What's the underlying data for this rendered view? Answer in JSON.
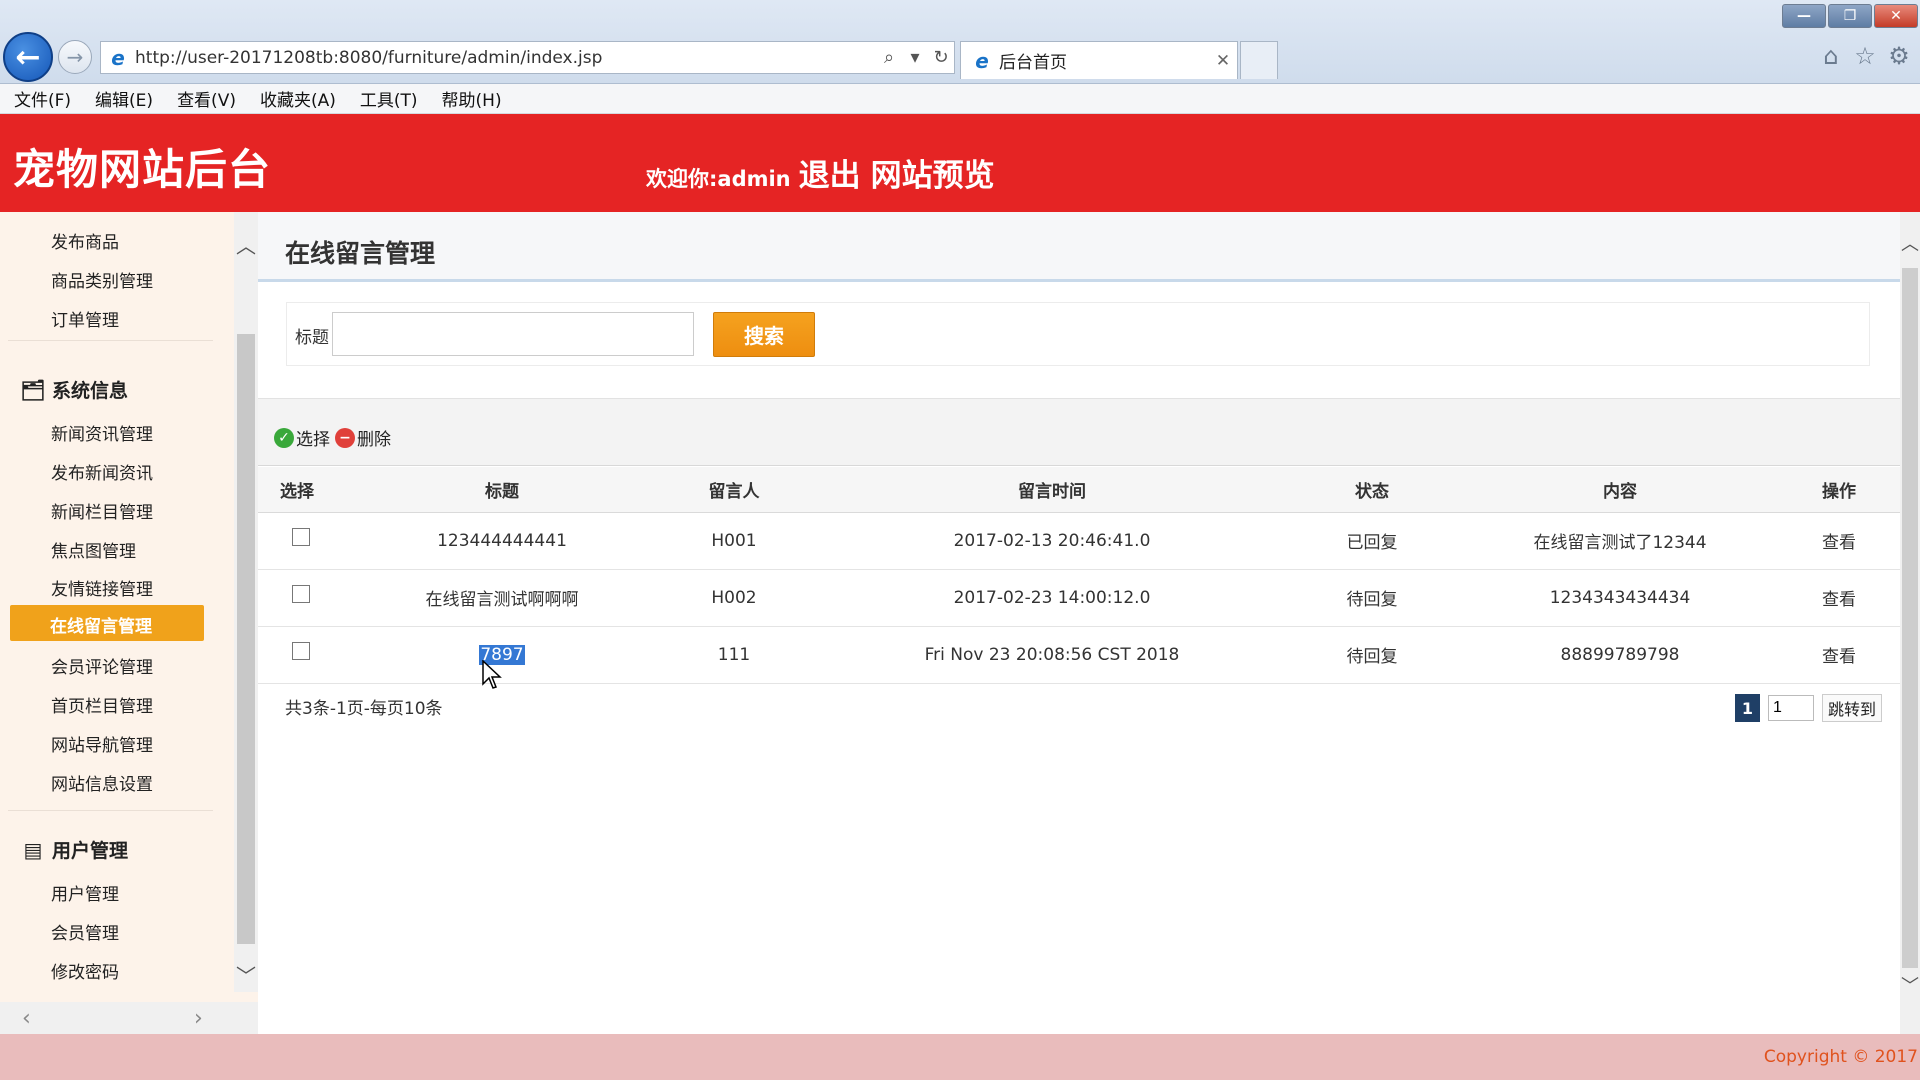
{
  "browser": {
    "url": "http://user-20171208tb:8080/furniture/admin/index.jsp",
    "tab_title": "后台首页",
    "menu": [
      "文件(F)",
      "编辑(E)",
      "查看(V)",
      "收藏夹(A)",
      "工具(T)",
      "帮助(H)"
    ]
  },
  "header": {
    "site_title": "宠物网站后台",
    "welcome": "欢迎你:admin",
    "logout": "退出",
    "preview": "网站预览",
    "bg_color": "#e52424"
  },
  "sidebar": {
    "top_links": [
      "发布商品",
      "商品类别管理",
      "订单管理"
    ],
    "group_system": {
      "title": "系统信息",
      "items": [
        "新闻资讯管理",
        "发布新闻资讯",
        "新闻栏目管理",
        "焦点图管理",
        "友情链接管理",
        "在线留言管理",
        "会员评论管理",
        "首页栏目管理",
        "网站导航管理",
        "网站信息设置"
      ],
      "active": "在线留言管理"
    },
    "group_user": {
      "title": "用户管理",
      "items": [
        "用户管理",
        "会员管理",
        "修改密码"
      ]
    }
  },
  "main": {
    "page_title": "在线留言管理",
    "search": {
      "label": "标题",
      "value": "",
      "button": "搜索"
    },
    "toolbar": {
      "select": "选择",
      "delete": "删除"
    },
    "table": {
      "headers": [
        "选择",
        "标题",
        "留言人",
        "留言时间",
        "状态",
        "内容",
        "操作"
      ],
      "rows": [
        {
          "title": "123444444441",
          "author": "H001",
          "time": "2017-02-13 20:46:41.0",
          "status": "已回复",
          "content": "在线留言测试了12344",
          "action": "查看"
        },
        {
          "title": "在线留言测试啊啊啊",
          "author": "H002",
          "time": "2017-02-23 14:00:12.0",
          "status": "待回复",
          "content": "1234343434434",
          "action": "查看"
        },
        {
          "title": "7897",
          "author": "111",
          "time": "Fri Nov 23 20:08:56 CST 2018",
          "status": "待回复",
          "content": "88899789798",
          "action": "查看"
        }
      ]
    },
    "pager": {
      "info": "共3条-1页-每页10条",
      "current": "1",
      "input": "1",
      "go": "跳转到"
    }
  },
  "footer": {
    "copyright": "Copyright © 2017"
  }
}
